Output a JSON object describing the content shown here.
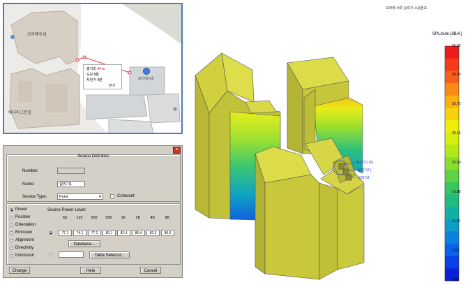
{
  "map": {
    "labels": [
      "보라매우성",
      "보라매서초",
      "베터러그린빌"
    ],
    "popup": {
      "rows": [
        {
          "k": "총거리",
          "v": "44 m"
        },
        {
          "k": "도보",
          "v": "8분"
        },
        {
          "k": "자전거",
          "v": "4분"
        },
        {
          "k": "",
          "v": "닫기"
        }
      ]
    }
  },
  "dialog": {
    "title": "Source Definition",
    "close_label": "×",
    "number_label": "Number:",
    "number_value": "",
    "name_label": "Name:",
    "name_value": "실외기1",
    "source_type_label": "Source Type:",
    "source_type_value": "Point",
    "coherent_label": "Coherent",
    "options": [
      "Power",
      "Position",
      "Orientation",
      "Emission",
      "Alignment",
      "Directivity",
      "Immission"
    ],
    "selected_option": "Power",
    "spl_label": "Source Power Level:",
    "frequencies": [
      "63",
      "125",
      "250",
      "500",
      "1K",
      "2K",
      "4K",
      "8K"
    ],
    "levels": [
      "77.1",
      "74.1",
      "77.2",
      "82.1",
      "82.4",
      "86.4",
      "82.3",
      "80.6"
    ],
    "database_label": "Database...",
    "table_selector_label": "Table Selector...",
    "change_label": "Change",
    "help_label": "Help",
    "cancel_label": "Cancel"
  },
  "view3d": {
    "title": "보라매 서측 실외기 소음분포",
    "annotations": [
      "실외기1 (0)",
      "실외기2 (",
      "실외기3"
    ]
  },
  "colorbar": {
    "title": "SPL/side [dB/A]",
    "ticks": [
      "45.00",
      "39.38",
      "33.75",
      "28.13",
      "22.50",
      "16.88",
      "11.25",
      "5.63",
      "0.00"
    ],
    "colors": [
      "#ee1c1c",
      "#f43a1a",
      "#f7601a",
      "#f98a16",
      "#fbb010",
      "#f7d20a",
      "#eded08",
      "#d6ee0e",
      "#b2e81a",
      "#88de2c",
      "#5ed244",
      "#38c65e",
      "#20bc7e",
      "#12b0a2",
      "#0c9ec6",
      "#0a82de",
      "#0a62e8",
      "#0a40e6",
      "#0a20d8"
    ]
  }
}
